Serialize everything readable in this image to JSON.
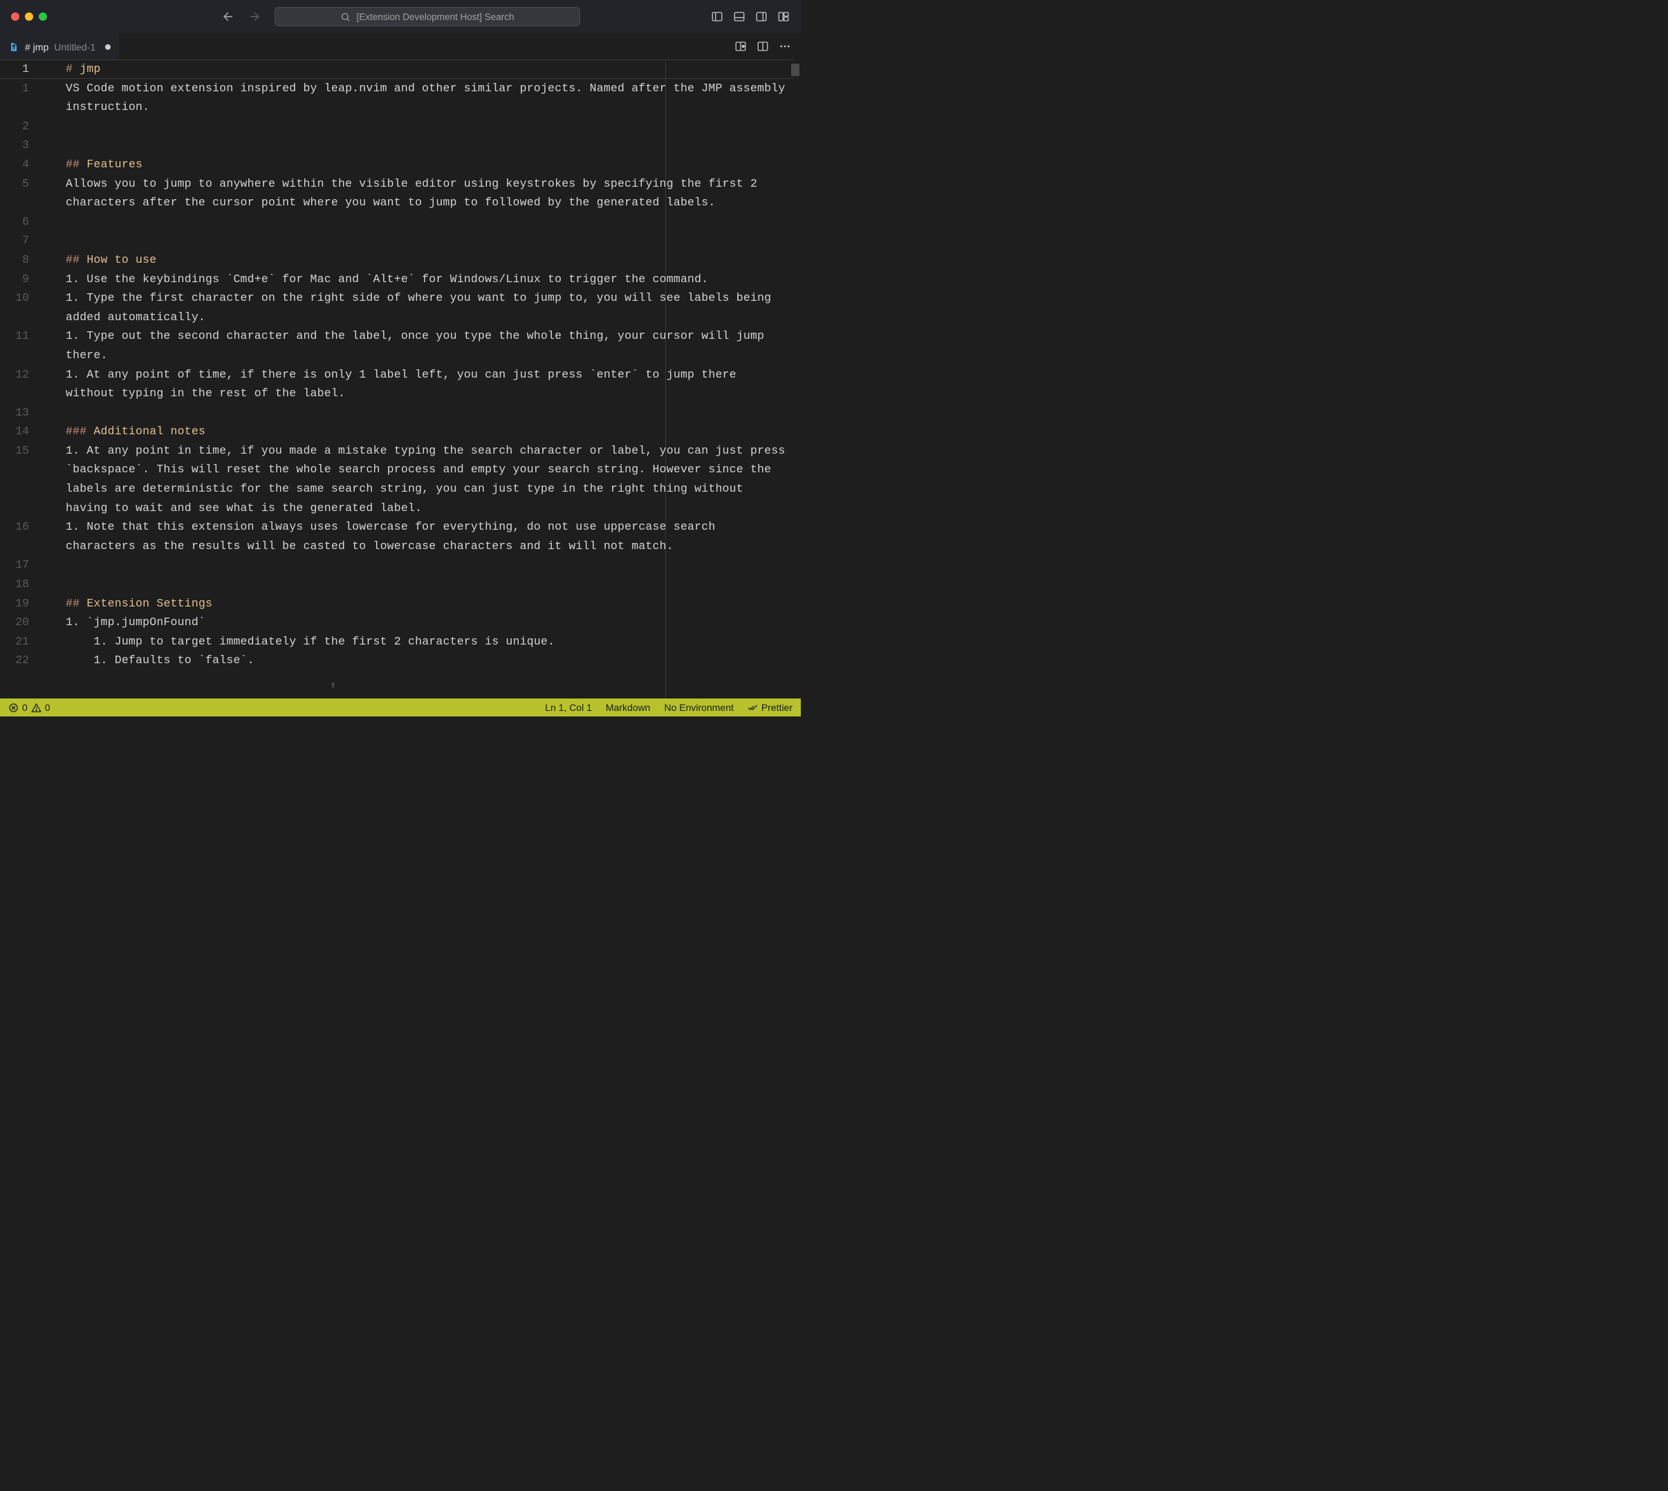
{
  "titlebar": {
    "search_placeholder": "[Extension Development Host] Search"
  },
  "tab": {
    "label": "# jmp",
    "sublabel": "Untitled-1"
  },
  "editor": {
    "lines": [
      {
        "n": "1",
        "active": true,
        "spans": [
          {
            "t": "#",
            "c": "md-hash"
          },
          {
            "t": " "
          },
          {
            "t": "jmp",
            "c": "md-h"
          }
        ]
      },
      {
        "n": "1",
        "spans": [
          {
            "t": "VS Code motion extension inspired by leap.nvim and other similar projects. Named after the JMP assembly instruction."
          }
        ]
      },
      {
        "n": "2",
        "spans": [
          {
            "t": ""
          }
        ]
      },
      {
        "n": "3",
        "spans": [
          {
            "t": ""
          }
        ]
      },
      {
        "n": "4",
        "spans": [
          {
            "t": "##",
            "c": "md-hash"
          },
          {
            "t": " "
          },
          {
            "t": "Features",
            "c": "md-h"
          }
        ]
      },
      {
        "n": "5",
        "spans": [
          {
            "t": "Allows you to jump to anywhere within the visible editor using keystrokes by specifying the first 2 characters after the cursor point where you want to jump to followed by the generated labels."
          }
        ]
      },
      {
        "n": "6",
        "spans": [
          {
            "t": ""
          }
        ]
      },
      {
        "n": "7",
        "spans": [
          {
            "t": ""
          }
        ]
      },
      {
        "n": "8",
        "spans": [
          {
            "t": "##",
            "c": "md-hash"
          },
          {
            "t": " "
          },
          {
            "t": "How to use",
            "c": "md-h"
          }
        ]
      },
      {
        "n": "9",
        "spans": [
          {
            "t": "1. Use the keybindings `Cmd+e` for Mac and `Alt+e` for Windows/Linux to trigger the command."
          }
        ]
      },
      {
        "n": "10",
        "spans": [
          {
            "t": "1. Type the first character on the right side of where you want to jump to, you will see labels being added automatically."
          }
        ]
      },
      {
        "n": "11",
        "spans": [
          {
            "t": "1. Type out the second character and the label, once you type the whole thing, your cursor will jump there."
          }
        ]
      },
      {
        "n": "12",
        "spans": [
          {
            "t": "1. At any point of time, if there is only 1 label left, you can just press `enter` to jump there without typing in the rest of the label."
          }
        ]
      },
      {
        "n": "13",
        "spans": [
          {
            "t": ""
          }
        ]
      },
      {
        "n": "14",
        "spans": [
          {
            "t": "###",
            "c": "md-hash"
          },
          {
            "t": " "
          },
          {
            "t": "Additional notes",
            "c": "md-h"
          }
        ]
      },
      {
        "n": "15",
        "spans": [
          {
            "t": "1. At any point in time, if you made a mistake typing the search character or label, you can just press `backspace`. This will reset the whole search process and empty your search string. However since the labels are deterministic for the same search string, you can just type in the right thing without having to wait and see what is the generated label."
          }
        ]
      },
      {
        "n": "16",
        "spans": [
          {
            "t": "1. Note that this extension always uses lowercase for everything, do not use uppercase search characters as the results will be casted to lowercase characters and it will not match."
          }
        ]
      },
      {
        "n": "17",
        "spans": [
          {
            "t": ""
          }
        ]
      },
      {
        "n": "18",
        "spans": [
          {
            "t": ""
          }
        ]
      },
      {
        "n": "19",
        "spans": [
          {
            "t": "##",
            "c": "md-hash"
          },
          {
            "t": " "
          },
          {
            "t": "Extension Settings",
            "c": "md-h"
          }
        ]
      },
      {
        "n": "20",
        "spans": [
          {
            "t": "1. `jmp.jumpOnFound`"
          }
        ]
      },
      {
        "n": "21",
        "spans": [
          {
            "t": "    1. Jump to target immediately if the first 2 characters is unique."
          }
        ]
      },
      {
        "n": "22",
        "spans": [
          {
            "t": "    1. Defaults to `false`."
          }
        ]
      }
    ]
  },
  "status": {
    "errors": "0",
    "warnings": "0",
    "position": "Ln 1, Col 1",
    "language": "Markdown",
    "environment": "No Environment",
    "formatter": "Prettier"
  }
}
